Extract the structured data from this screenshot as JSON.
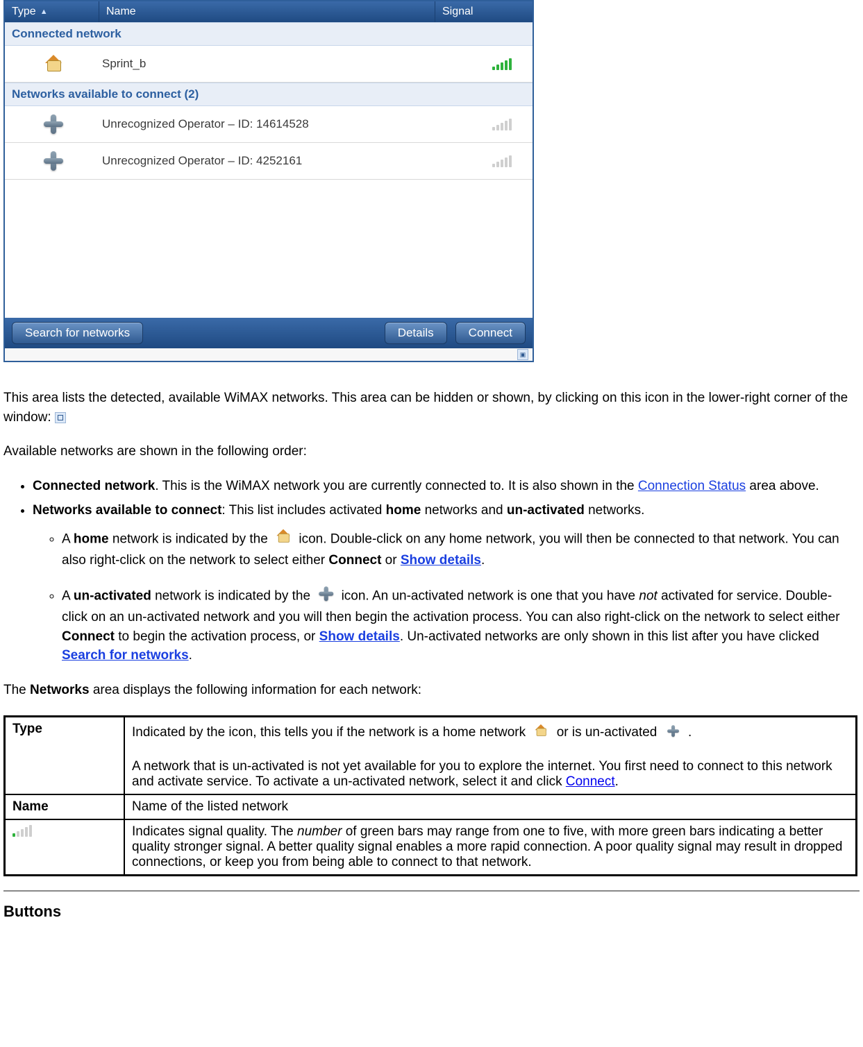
{
  "wimax": {
    "columns": {
      "type": "Type",
      "name": "Name",
      "signal": "Signal"
    },
    "sections": {
      "connected_title": "Connected network",
      "available_title": "Networks available to connect (2)"
    },
    "connected": {
      "name": "Sprint_b",
      "signal_level": 5
    },
    "available": [
      {
        "name": "Unrecognized Operator – ID: 14614528",
        "signal_level": 0
      },
      {
        "name": "Unrecognized Operator – ID: 4252161",
        "signal_level": 0
      }
    ],
    "buttons": {
      "search": "Search for networks",
      "details": "Details",
      "connect": "Connect"
    }
  },
  "doc": {
    "p1a": "This area lists the detected, available WiMAX networks. This area can be hidden or shown, by clicking on this icon in the lower-right corner of the window: ",
    "p2": "Available networks are shown in the following order:",
    "li1_b": "Connected network",
    "li1_t": ". This is the WiMAX network you are currently connected to. It is also shown in the ",
    "li1_link": "Connection Status",
    "li1_end": " area above.",
    "li2_b": "Networks available to connect",
    "li2_t": ": This list includes activated ",
    "li2_home": "home",
    "li2_mid": " networks and ",
    "li2_un": "un-activated",
    "li2_end": " networks.",
    "sub1_a": "A ",
    "sub1_b": "home",
    "sub1_c": " network is indicated by the ",
    "sub1_d": " icon. Double-click on any home network, you will then be connected to that network. You can also right-click on the network to select either ",
    "sub1_connect": "Connect",
    "sub1_or": " or ",
    "sub1_link": "Show details",
    "sub1_dot": ".",
    "sub2_a": "A ",
    "sub2_b": "un-activated",
    "sub2_c": " network is indicated by the ",
    "sub2_d": " icon. An un-activated network is one that you have ",
    "sub2_not": "not",
    "sub2_e": " activated for service. Double-click on an un-activated network and you will then begin the activation process. You can also right-click on the network to select either ",
    "sub2_connect": "Connect",
    "sub2_f": " to begin the activation process, or ",
    "sub2_link1": "Show details",
    "sub2_g": ". Un-activated networks are only shown in this list after you have clicked ",
    "sub2_link2": "Search for networks",
    "sub2_dot": ".",
    "p3a": "The ",
    "p3b": "Networks",
    "p3c": " area displays the following information for each network:"
  },
  "table": {
    "type_label": "Type",
    "type_l1a": "Indicated by the icon, this tells you if the network is a home network ",
    "type_l1b": " or is un-activated ",
    "type_l1c": ".",
    "type_l2": "A network that is un-activated is not yet available for you to explore the internet. You first need to connect to this network and activate service. To activate a un-activated network, select it and click ",
    "type_link": "Connect",
    "type_dot": ".",
    "name_label": "Name",
    "name_val": "Name of the listed network",
    "signal_val_a": "Indicates signal quality. The ",
    "signal_val_num": "number",
    "signal_val_b": " of green bars may range from one to five, with more green bars indicating a better quality stronger signal. A better quality signal enables a more rapid connection. A poor quality signal may result in dropped connections, or keep you from being able to connect to that network."
  },
  "buttons_heading": "Buttons"
}
